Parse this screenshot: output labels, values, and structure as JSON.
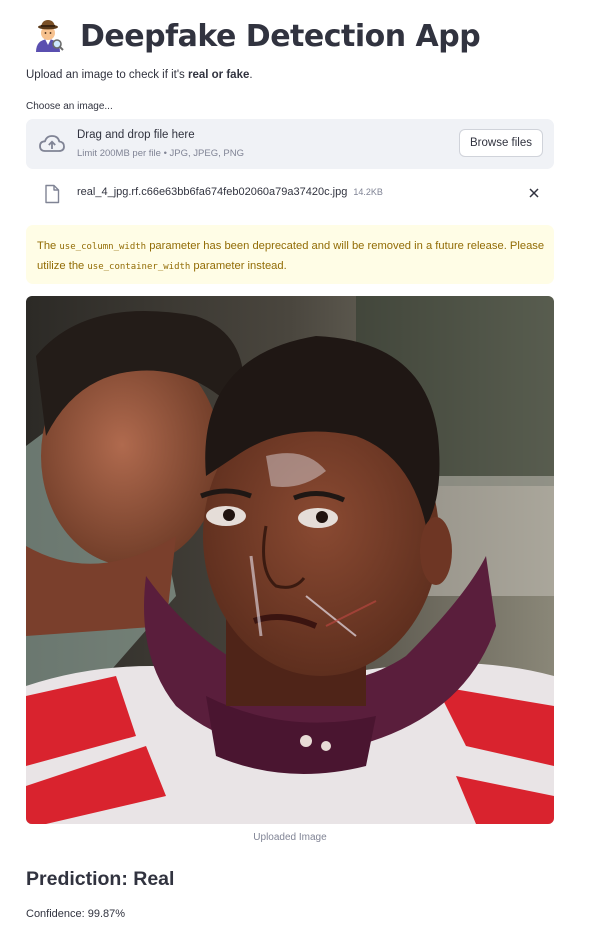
{
  "app": {
    "title": "Deepfake Detection App",
    "title_icon": "detective-emoji-icon"
  },
  "intro": {
    "text_before": "Upload an image to check if it's ",
    "emphasis": "real or fake",
    "text_after": "."
  },
  "uploader": {
    "label": "Choose an image...",
    "drop_text": "Drag and drop file here",
    "limit_text": "Limit 200MB per file • JPG, JPEG, PNG",
    "browse_label": "Browse files",
    "upload_icon": "cloud-upload-icon"
  },
  "uploaded_file": {
    "name": "real_4_jpg.rf.c66e63bb6fa674feb02060a79a37420c.jpg",
    "size": "14.2KB",
    "file_icon": "file-icon",
    "remove_icon": "close-icon"
  },
  "warning": {
    "part1": "The ",
    "code1": "use_column_width",
    "part2": " parameter has been deprecated and will be removed in a future release. Please utilize the ",
    "code2": "use_container_width",
    "part3": " parameter instead."
  },
  "image": {
    "caption": "Uploaded Image"
  },
  "result": {
    "prediction": "Prediction: Real",
    "confidence": "Confidence: 99.87%"
  },
  "colors": {
    "text": "#31333f",
    "muted": "#808495",
    "dropzone_bg": "#f0f2f6",
    "warning_bg": "#fffde6",
    "warning_text": "#926c05"
  }
}
